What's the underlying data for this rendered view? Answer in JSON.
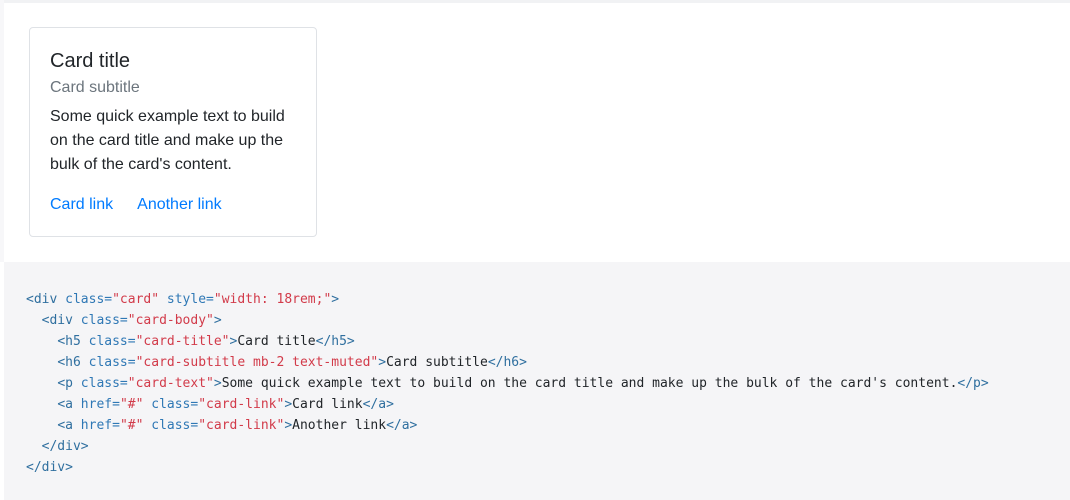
{
  "card": {
    "title": "Card title",
    "subtitle": "Card subtitle",
    "text": "Some quick example text to build on the card title and make up the bulk of the card's content.",
    "links": [
      {
        "label": "Card link"
      },
      {
        "label": "Another link"
      }
    ]
  },
  "code": {
    "line1": {
      "open_tag": "<div",
      "attr1": "class=",
      "val1": "\"card\"",
      "attr2": "style=",
      "val2": "\"width: 18rem;\"",
      "close_bracket": ">"
    },
    "line2": {
      "open_tag": "<div",
      "attr1": "class=",
      "val1": "\"card-body\"",
      "close_bracket": ">"
    },
    "line3": {
      "open_tag": "<h5",
      "attr1": "class=",
      "val1": "\"card-title\"",
      "close_bracket": ">",
      "text": "Card title",
      "end_tag": "</h5>"
    },
    "line4": {
      "open_tag": "<h6",
      "attr1": "class=",
      "val1": "\"card-subtitle mb-2 text-muted\"",
      "close_bracket": ">",
      "text": "Card subtitle",
      "end_tag": "</h6>"
    },
    "line5": {
      "open_tag": "<p",
      "attr1": "class=",
      "val1": "\"card-text\"",
      "close_bracket": ">",
      "text": "Some quick example text to build on the card title and make up the bulk of the card's content.",
      "end_tag": "</p>"
    },
    "line6": {
      "open_tag": "<a",
      "attr1": "href=",
      "val1": "\"#\"",
      "attr2": "class=",
      "val2": "\"card-link\"",
      "close_bracket": ">",
      "text": "Card link",
      "end_tag": "</a>"
    },
    "line7": {
      "open_tag": "<a",
      "attr1": "href=",
      "val1": "\"#\"",
      "attr2": "class=",
      "val2": "\"card-link\"",
      "close_bracket": ">",
      "text": "Another link",
      "end_tag": "</a>"
    },
    "line8": {
      "end_tag": "</div>"
    },
    "line9": {
      "end_tag": "</div>"
    }
  },
  "colors": {
    "link": "#007bff",
    "muted": "#6c757d",
    "code_tag": "#2f6f9f",
    "code_string": "#d23b4a",
    "code_background": "#f5f5f7"
  }
}
